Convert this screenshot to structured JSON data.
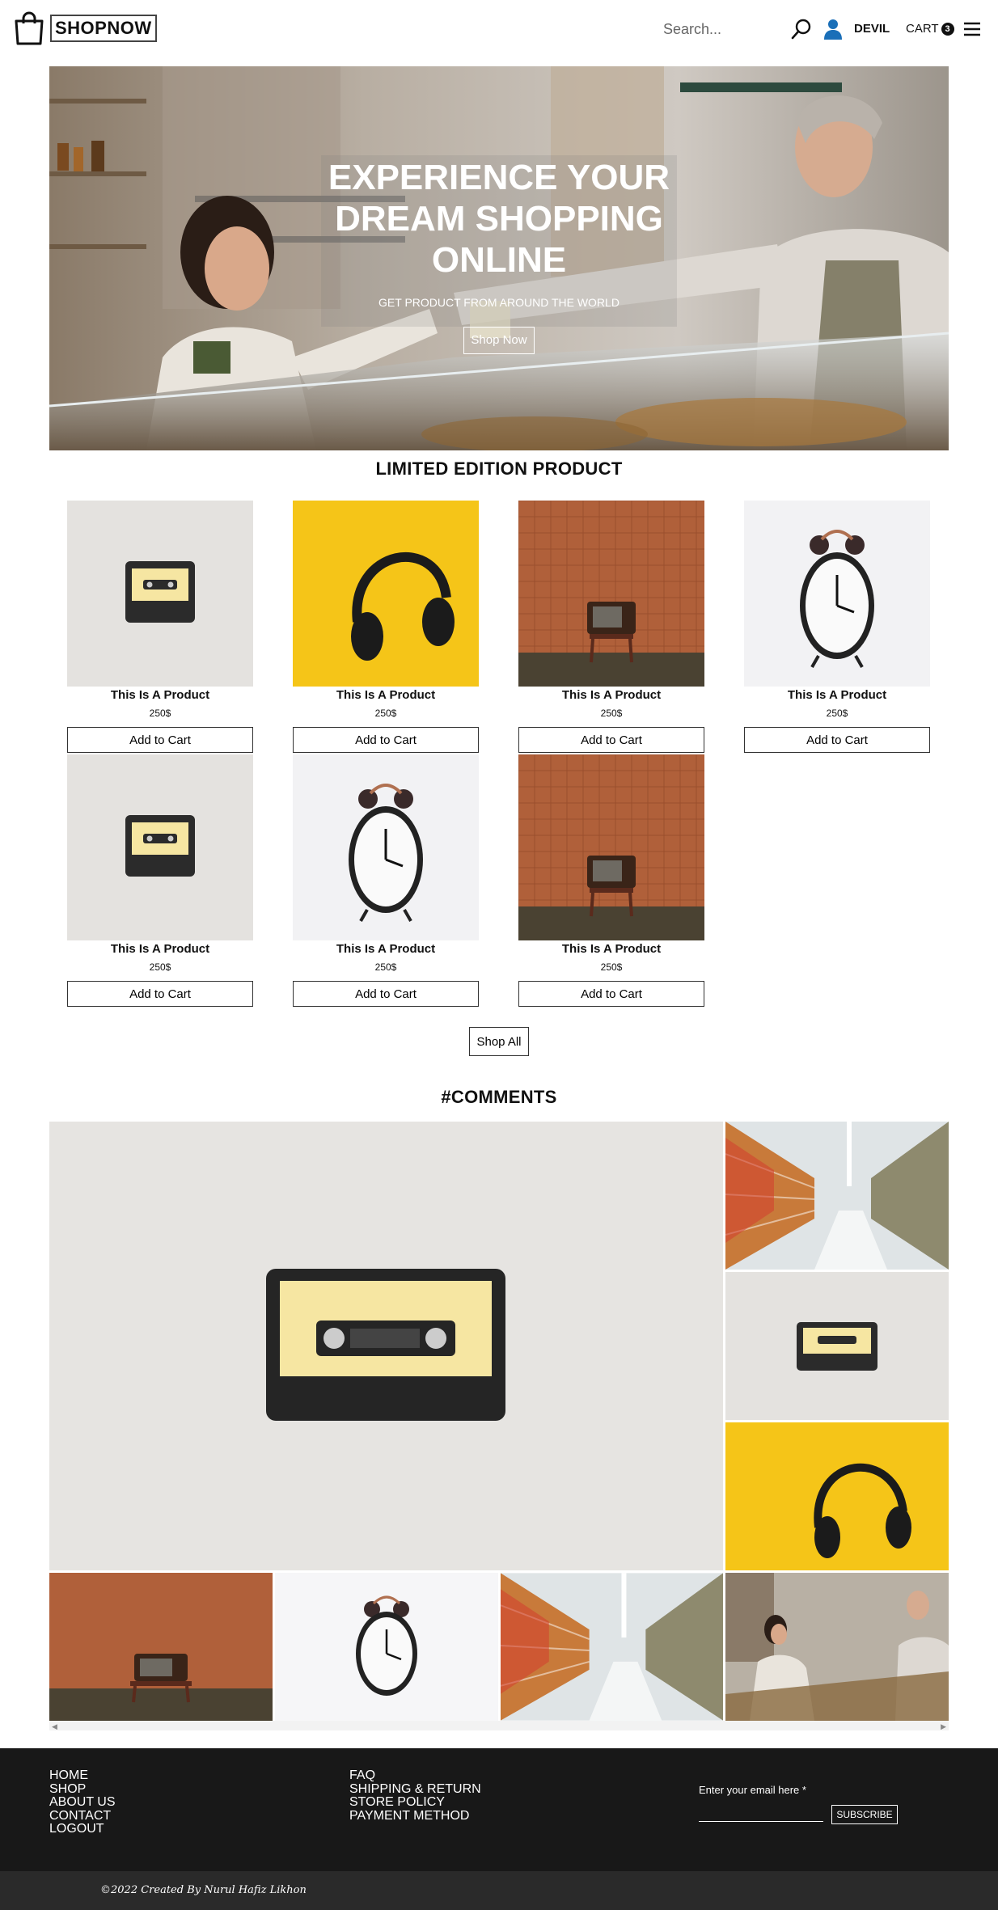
{
  "header": {
    "logo_text": "SHOPNOW",
    "search_placeholder": "Search...",
    "username": "DEVIL",
    "cart_label": "CART",
    "cart_count": "3",
    "icons": [
      "shopping-bag-icon",
      "search-icon",
      "user-icon",
      "hamburger-menu-icon"
    ]
  },
  "hero": {
    "title": "EXPERIENCE YOUR DREAM SHOPPING ONLINE",
    "subtitle": "GET PRODUCT FROM AROUND THE WORLD",
    "button": "Shop Now"
  },
  "limited": {
    "title": "LIMITED EDITION PRODUCT",
    "products": [
      {
        "name": "This Is A Product",
        "price": "250$",
        "button": "Add to Cart",
        "image": "cassette"
      },
      {
        "name": "This Is A Product",
        "price": "250$",
        "button": "Add to Cart",
        "image": "headphones"
      },
      {
        "name": "This Is A Product",
        "price": "250$",
        "button": "Add to Cart",
        "image": "tv"
      },
      {
        "name": "This Is A Product",
        "price": "250$",
        "button": "Add to Cart",
        "image": "clock"
      },
      {
        "name": "This Is A Product",
        "price": "250$",
        "button": "Add to Cart",
        "image": "cassette"
      },
      {
        "name": "This Is A Product",
        "price": "250$",
        "button": "Add to Cart",
        "image": "clock"
      },
      {
        "name": "This Is A Product",
        "price": "250$",
        "button": "Add to Cart",
        "image": "tv"
      }
    ],
    "shop_all": "Shop All"
  },
  "comments": {
    "title": "#COMMENTS"
  },
  "footer": {
    "col1": [
      "HOME",
      "SHOP",
      "ABOUT US",
      "CONTACT",
      "LOGOUT"
    ],
    "col2": [
      "FAQ",
      "SHIPPING & RETURN",
      "STORE POLICY",
      "PAYMENT METHOD"
    ],
    "email_label": "Enter your email here *",
    "subscribe": "SUBSCRIBE",
    "copyright": "©2022 Created By Nurul Hafiz Likhon"
  },
  "colors": {
    "footer_bg": "#181818",
    "copyright_bg": "#2a2a2a",
    "user_icon": "#1a6fb8",
    "headphones_bg": "#f5c518",
    "tv_bg": "#b0603a"
  }
}
